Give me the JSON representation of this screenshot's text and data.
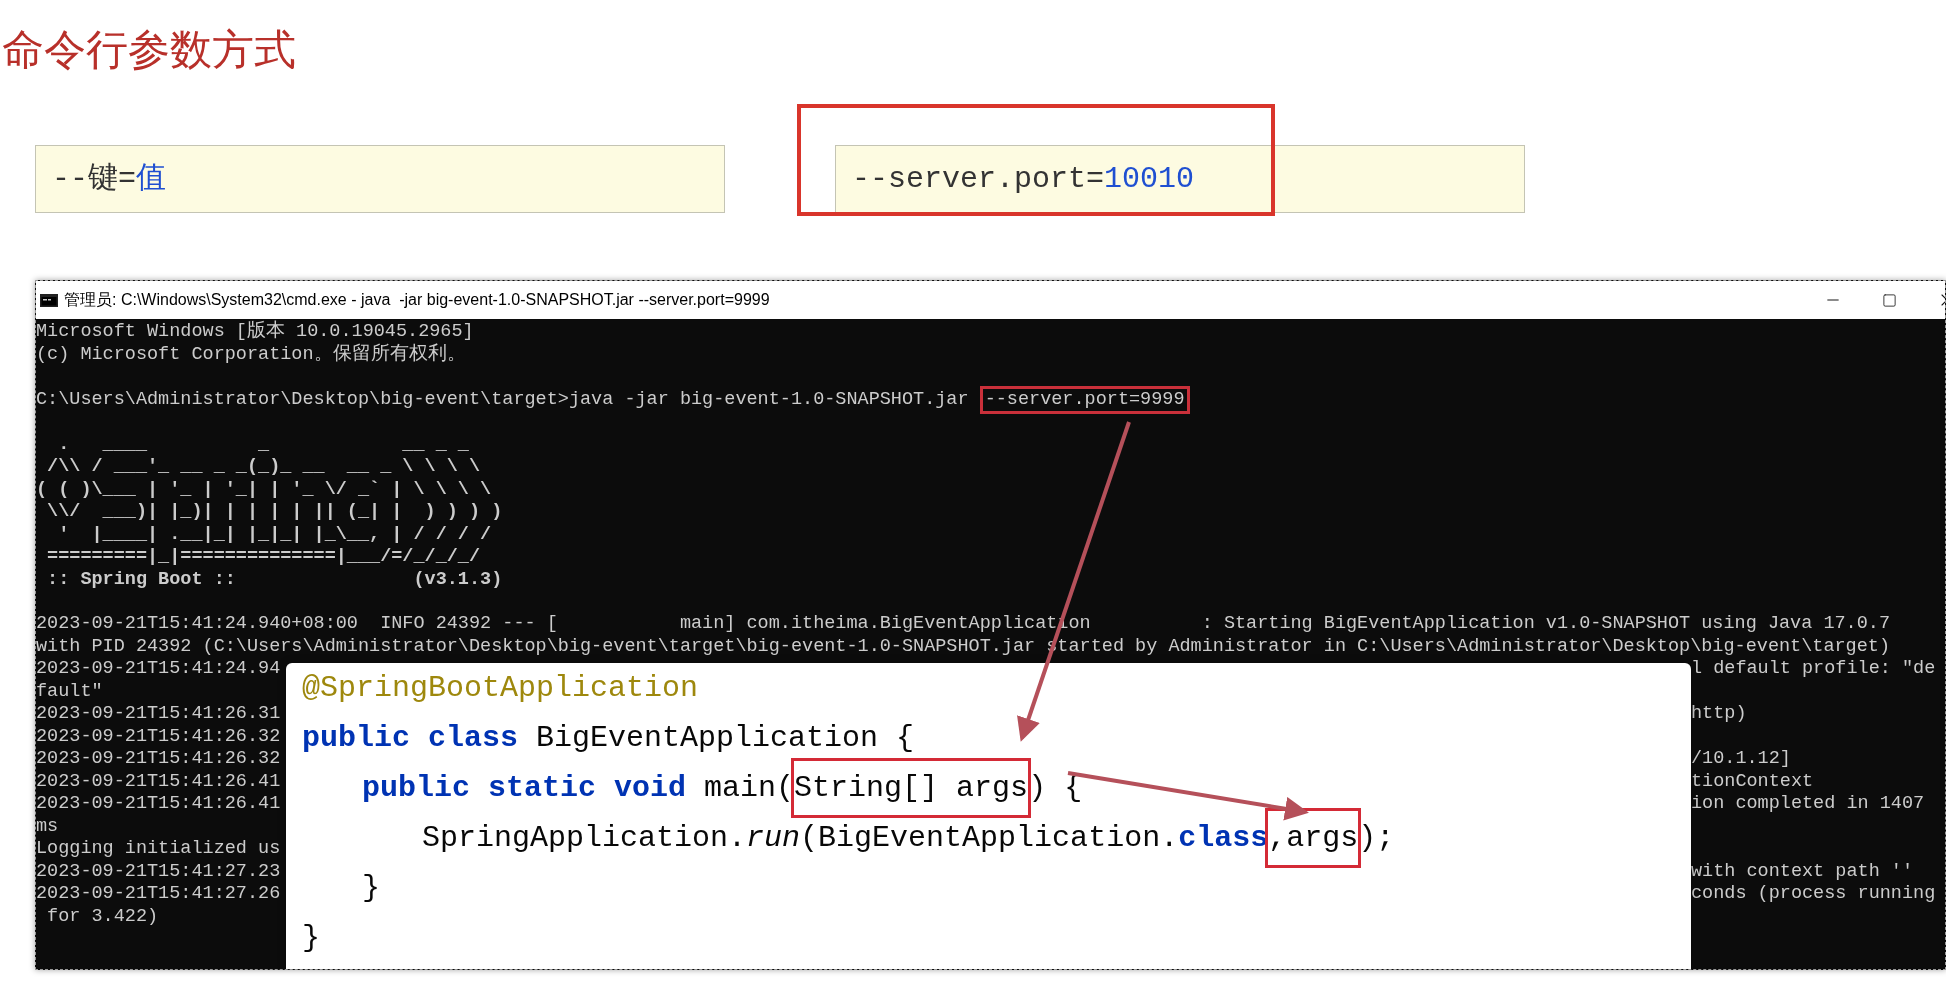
{
  "slide": {
    "title": "命令行参数方式",
    "syntax_boxes": [
      {
        "tokens": [
          {
            "text": "--键=",
            "kind": "plain"
          },
          {
            "text": "值",
            "kind": "value"
          }
        ],
        "highlighted": false
      },
      {
        "tokens": [
          {
            "text": "--server.port=",
            "kind": "plain"
          },
          {
            "text": "10010",
            "kind": "value"
          }
        ],
        "highlighted": true
      }
    ]
  },
  "terminal": {
    "title": "管理员: C:\\Windows\\System32\\cmd.exe - java  -jar big-event-1.0-SNAPSHOT.jar --server.port=9999",
    "header_lines": [
      "Microsoft Windows [版本 10.0.19045.2965]",
      "(c) Microsoft Corporation。保留所有权利。"
    ],
    "prompt": {
      "text": "C:\\Users\\Administrator\\Desktop\\big-event\\target>java -jar big-event-1.0-SNAPSHOT.jar ",
      "argument": "--server.port=9999"
    },
    "banner_lines": [
      "  .   ____          _            __ _ _",
      " /\\\\ / ___'_ __ _ _(_)_ __  __ _ \\ \\ \\ \\",
      "( ( )\\___ | '_ | '_| | '_ \\/ _` | \\ \\ \\ \\",
      " \\\\/  ___)| |_)| | | | | || (_| |  ) ) ) )",
      "  '  |____| .__|_| |_|_| |_\\__, | / / / /",
      " =========|_|==============|___/=/_/_/_/",
      " :: Spring Boot ::                (v3.1.3)"
    ],
    "log_lines": [
      {
        "kind": "full",
        "text": "2023-09-21T15:41:24.940+08:00  INFO 24392 --- [           main] com.itheima.BigEventApplication          : Starting BigEventApplication v1.0-SNAPSHOT using Java 17.0.7"
      },
      {
        "kind": "full",
        "text": "with PID 24392 (C:\\Users\\Administrator\\Desktop\\big-event\\target\\big-event-1.0-SNAPSHOT.jar started by Administrator in C:\\Users\\Administrator\\Desktop\\big-event\\target)"
      },
      {
        "kind": "split",
        "left": "2023-09-21T15:41:24.94",
        "right": "l default profile: \"de"
      },
      {
        "kind": "split",
        "left": "fault\""
      },
      {
        "kind": "split",
        "left": "2023-09-21T15:41:26.31",
        "right": "http)"
      },
      {
        "kind": "split",
        "left": "2023-09-21T15:41:26.32"
      },
      {
        "kind": "split",
        "left": "2023-09-21T15:41:26.32",
        "right": "/10.1.12]"
      },
      {
        "kind": "split",
        "left": "2023-09-21T15:41:26.41",
        "right": "tionContext"
      },
      {
        "kind": "split",
        "left": "2023-09-21T15:41:26.41",
        "right": "ion completed in 1407"
      },
      {
        "kind": "split",
        "left": "ms"
      },
      {
        "kind": "split",
        "left": "Logging initialized us"
      },
      {
        "kind": "split",
        "left": "2023-09-21T15:41:27.23",
        "right": "with context path ''"
      },
      {
        "kind": "split",
        "left": "2023-09-21T15:41:27.26",
        "right": "conds (process running"
      },
      {
        "kind": "split",
        "left": " for 3.422)"
      }
    ]
  },
  "code": {
    "lines": [
      {
        "tokens": [
          {
            "text": "@SpringBootApplication",
            "kind": "annotation"
          }
        ]
      },
      {
        "tokens": [
          {
            "text": "public class ",
            "kind": "keyword"
          },
          {
            "text": "BigEventApplication {",
            "kind": "plain"
          }
        ],
        "children": [
          {
            "tokens": [
              {
                "text": "public static void ",
                "kind": "keyword"
              },
              {
                "text": "main(",
                "kind": "plain"
              },
              {
                "text": "String[] args",
                "kind": "highlight"
              },
              {
                "text": ") {",
                "kind": "plain"
              }
            ],
            "children": [
              {
                "tokens": [
                  {
                    "text": "SpringApplication.",
                    "kind": "plain"
                  },
                  {
                    "text": "run",
                    "kind": "italic"
                  },
                  {
                    "text": "(BigEventApplication.",
                    "kind": "plain"
                  },
                  {
                    "text": "class",
                    "kind": "keyword"
                  },
                  {
                    "text": ",args",
                    "kind": "highlight"
                  },
                  {
                    "text": ");",
                    "kind": "plain"
                  }
                ]
              }
            ]
          },
          {
            "tokens": [
              {
                "text": "}",
                "kind": "plain"
              }
            ]
          }
        ]
      },
      {
        "tokens": [
          {
            "text": "}",
            "kind": "plain"
          }
        ]
      }
    ]
  }
}
